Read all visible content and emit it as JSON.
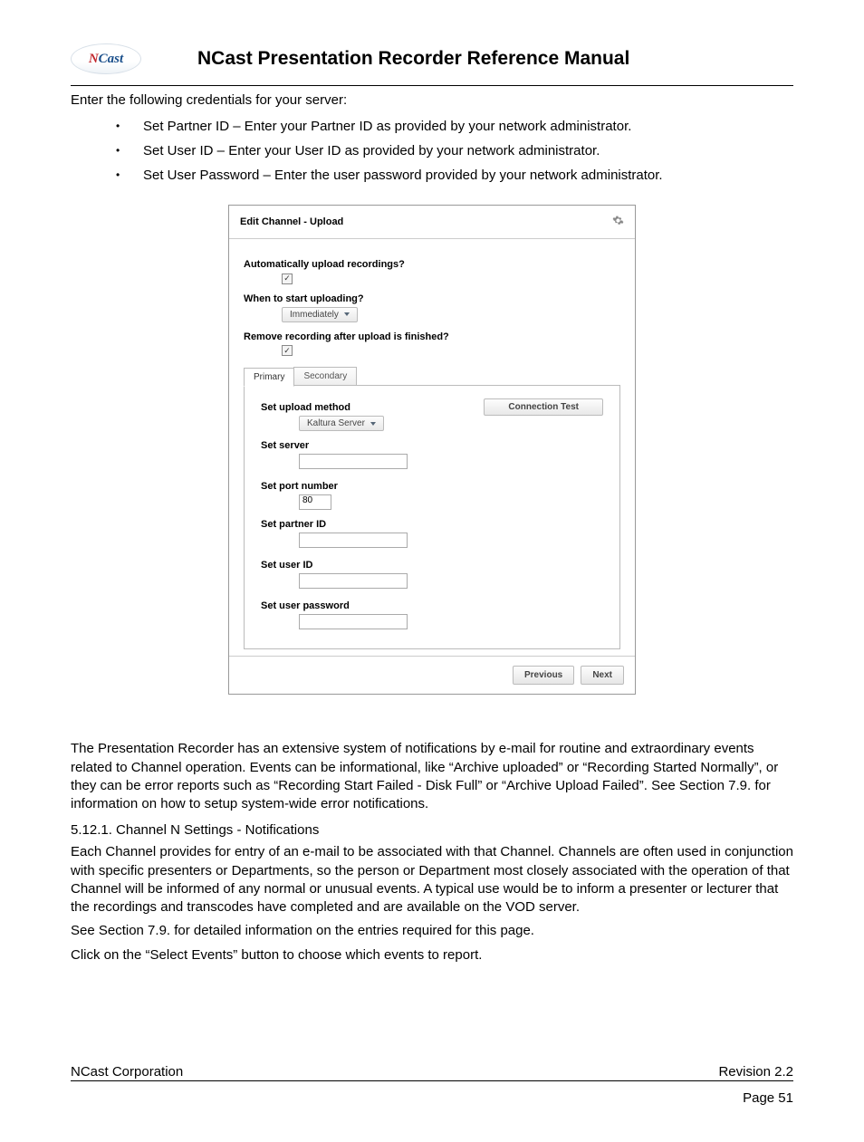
{
  "header": {
    "logo_text_1": "N",
    "logo_text_2": "Cast",
    "title": "NCast Presentation Recorder Reference Manual"
  },
  "intro": "Enter the following credentials for your server:",
  "bullets": [
    "Set Partner ID – Enter your Partner ID as provided by your network administrator.",
    "Set User ID – Enter your User ID as provided by your network administrator.",
    "Set User Password – Enter the user password provided by your network administrator."
  ],
  "panel": {
    "title": "Edit Channel - Upload",
    "q_auto": "Automatically upload recordings?",
    "q_when": "When to start uploading?",
    "when_value": "Immediately",
    "q_remove": "Remove recording after upload is finished?",
    "tab_primary": "Primary",
    "tab_secondary": "Secondary",
    "conn_test": "Connection Test",
    "f_method": "Set upload method",
    "method_value": "Kaltura Server",
    "f_server": "Set server",
    "server_value": "",
    "f_port": "Set port number",
    "port_value": "80",
    "f_partner": "Set partner ID",
    "partner_value": "",
    "f_user": "Set user ID",
    "user_value": "",
    "f_pass": "Set user password",
    "pass_value": "",
    "btn_prev": "Previous",
    "btn_next": "Next"
  },
  "para1": "The Presentation Recorder has an extensive system of notifications by e-mail for routine and extraordinary events related to Channel operation. Events can be informational, like “Archive uploaded” or “Recording Started Normally”, or they can be error reports such as “Recording Start Failed - Disk Full” or “Archive Upload Failed”. See Section 7.9. for information on how to setup system-wide error notifications.",
  "section": "5.12.1. Channel N Settings - Notifications",
  "para2": "Each Channel provides for entry of an e-mail to be associated with that Channel. Channels are often used in conjunction with specific presenters or Departments, so the person or Department most closely associated with the operation of that Channel will be informed of any normal or unusual events. A typical use would be to inform a presenter or lecturer that the recordings and transcodes have completed and are available on the VOD server.",
  "para3": "See Section 7.9. for detailed information on the entries required for this page.",
  "para4": "Click on the “Select Events” button to choose which events to report.",
  "footer": {
    "left": "NCast Corporation",
    "right": "Revision 2.2",
    "page": "Page 51"
  }
}
